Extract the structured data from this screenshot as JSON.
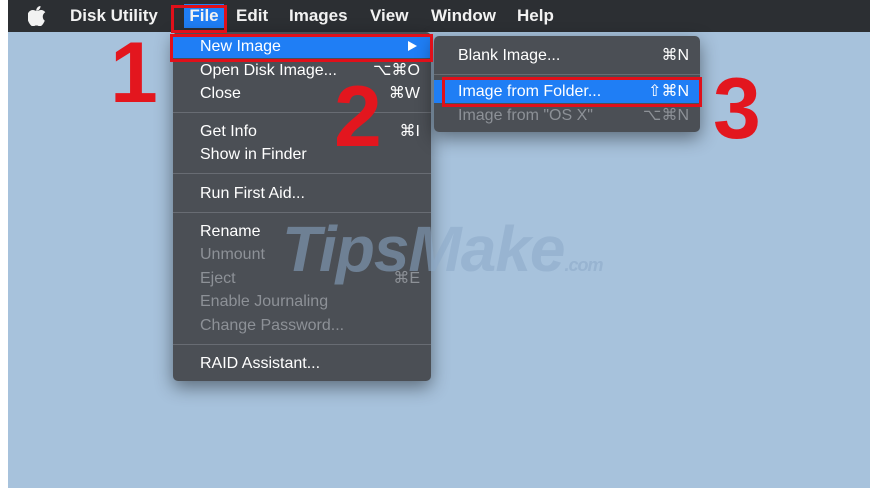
{
  "menubar": {
    "app_name": "Disk Utility",
    "menus": [
      "File",
      "Edit",
      "Images",
      "View",
      "Window",
      "Help"
    ]
  },
  "file_menu": {
    "items": [
      {
        "label": "New Image",
        "shortcut": ""
      },
      {
        "label": "Open Disk Image...",
        "shortcut": "⌥⌘O"
      },
      {
        "label": "Close",
        "shortcut": "⌘W"
      },
      {
        "label": "Get Info",
        "shortcut": "⌘I"
      },
      {
        "label": "Show in Finder",
        "shortcut": ""
      },
      {
        "label": "Run First Aid...",
        "shortcut": ""
      },
      {
        "label": "Rename",
        "shortcut": ""
      },
      {
        "label": "Unmount",
        "shortcut": ""
      },
      {
        "label": "Eject",
        "shortcut": "⌘E"
      },
      {
        "label": "Enable Journaling",
        "shortcut": ""
      },
      {
        "label": "Change Password...",
        "shortcut": ""
      },
      {
        "label": "RAID Assistant...",
        "shortcut": ""
      }
    ]
  },
  "new_image_submenu": {
    "items": [
      {
        "label": "Blank Image...",
        "shortcut": "⌘N"
      },
      {
        "label": "Image from Folder...",
        "shortcut": "⇧⌘N"
      },
      {
        "label": "Image from \"OS X\"",
        "shortcut": "⌥⌘N"
      }
    ]
  },
  "annotations": {
    "step1": "1",
    "step2": "2",
    "step3": "3"
  },
  "watermark": {
    "main": "TipsMake",
    "suffix": ".com"
  },
  "colors": {
    "highlight": "#1f7ef5",
    "annotation_red": "#e3161e",
    "desktop": "#a7c2dc",
    "menu_bg": "#4b4f55"
  }
}
